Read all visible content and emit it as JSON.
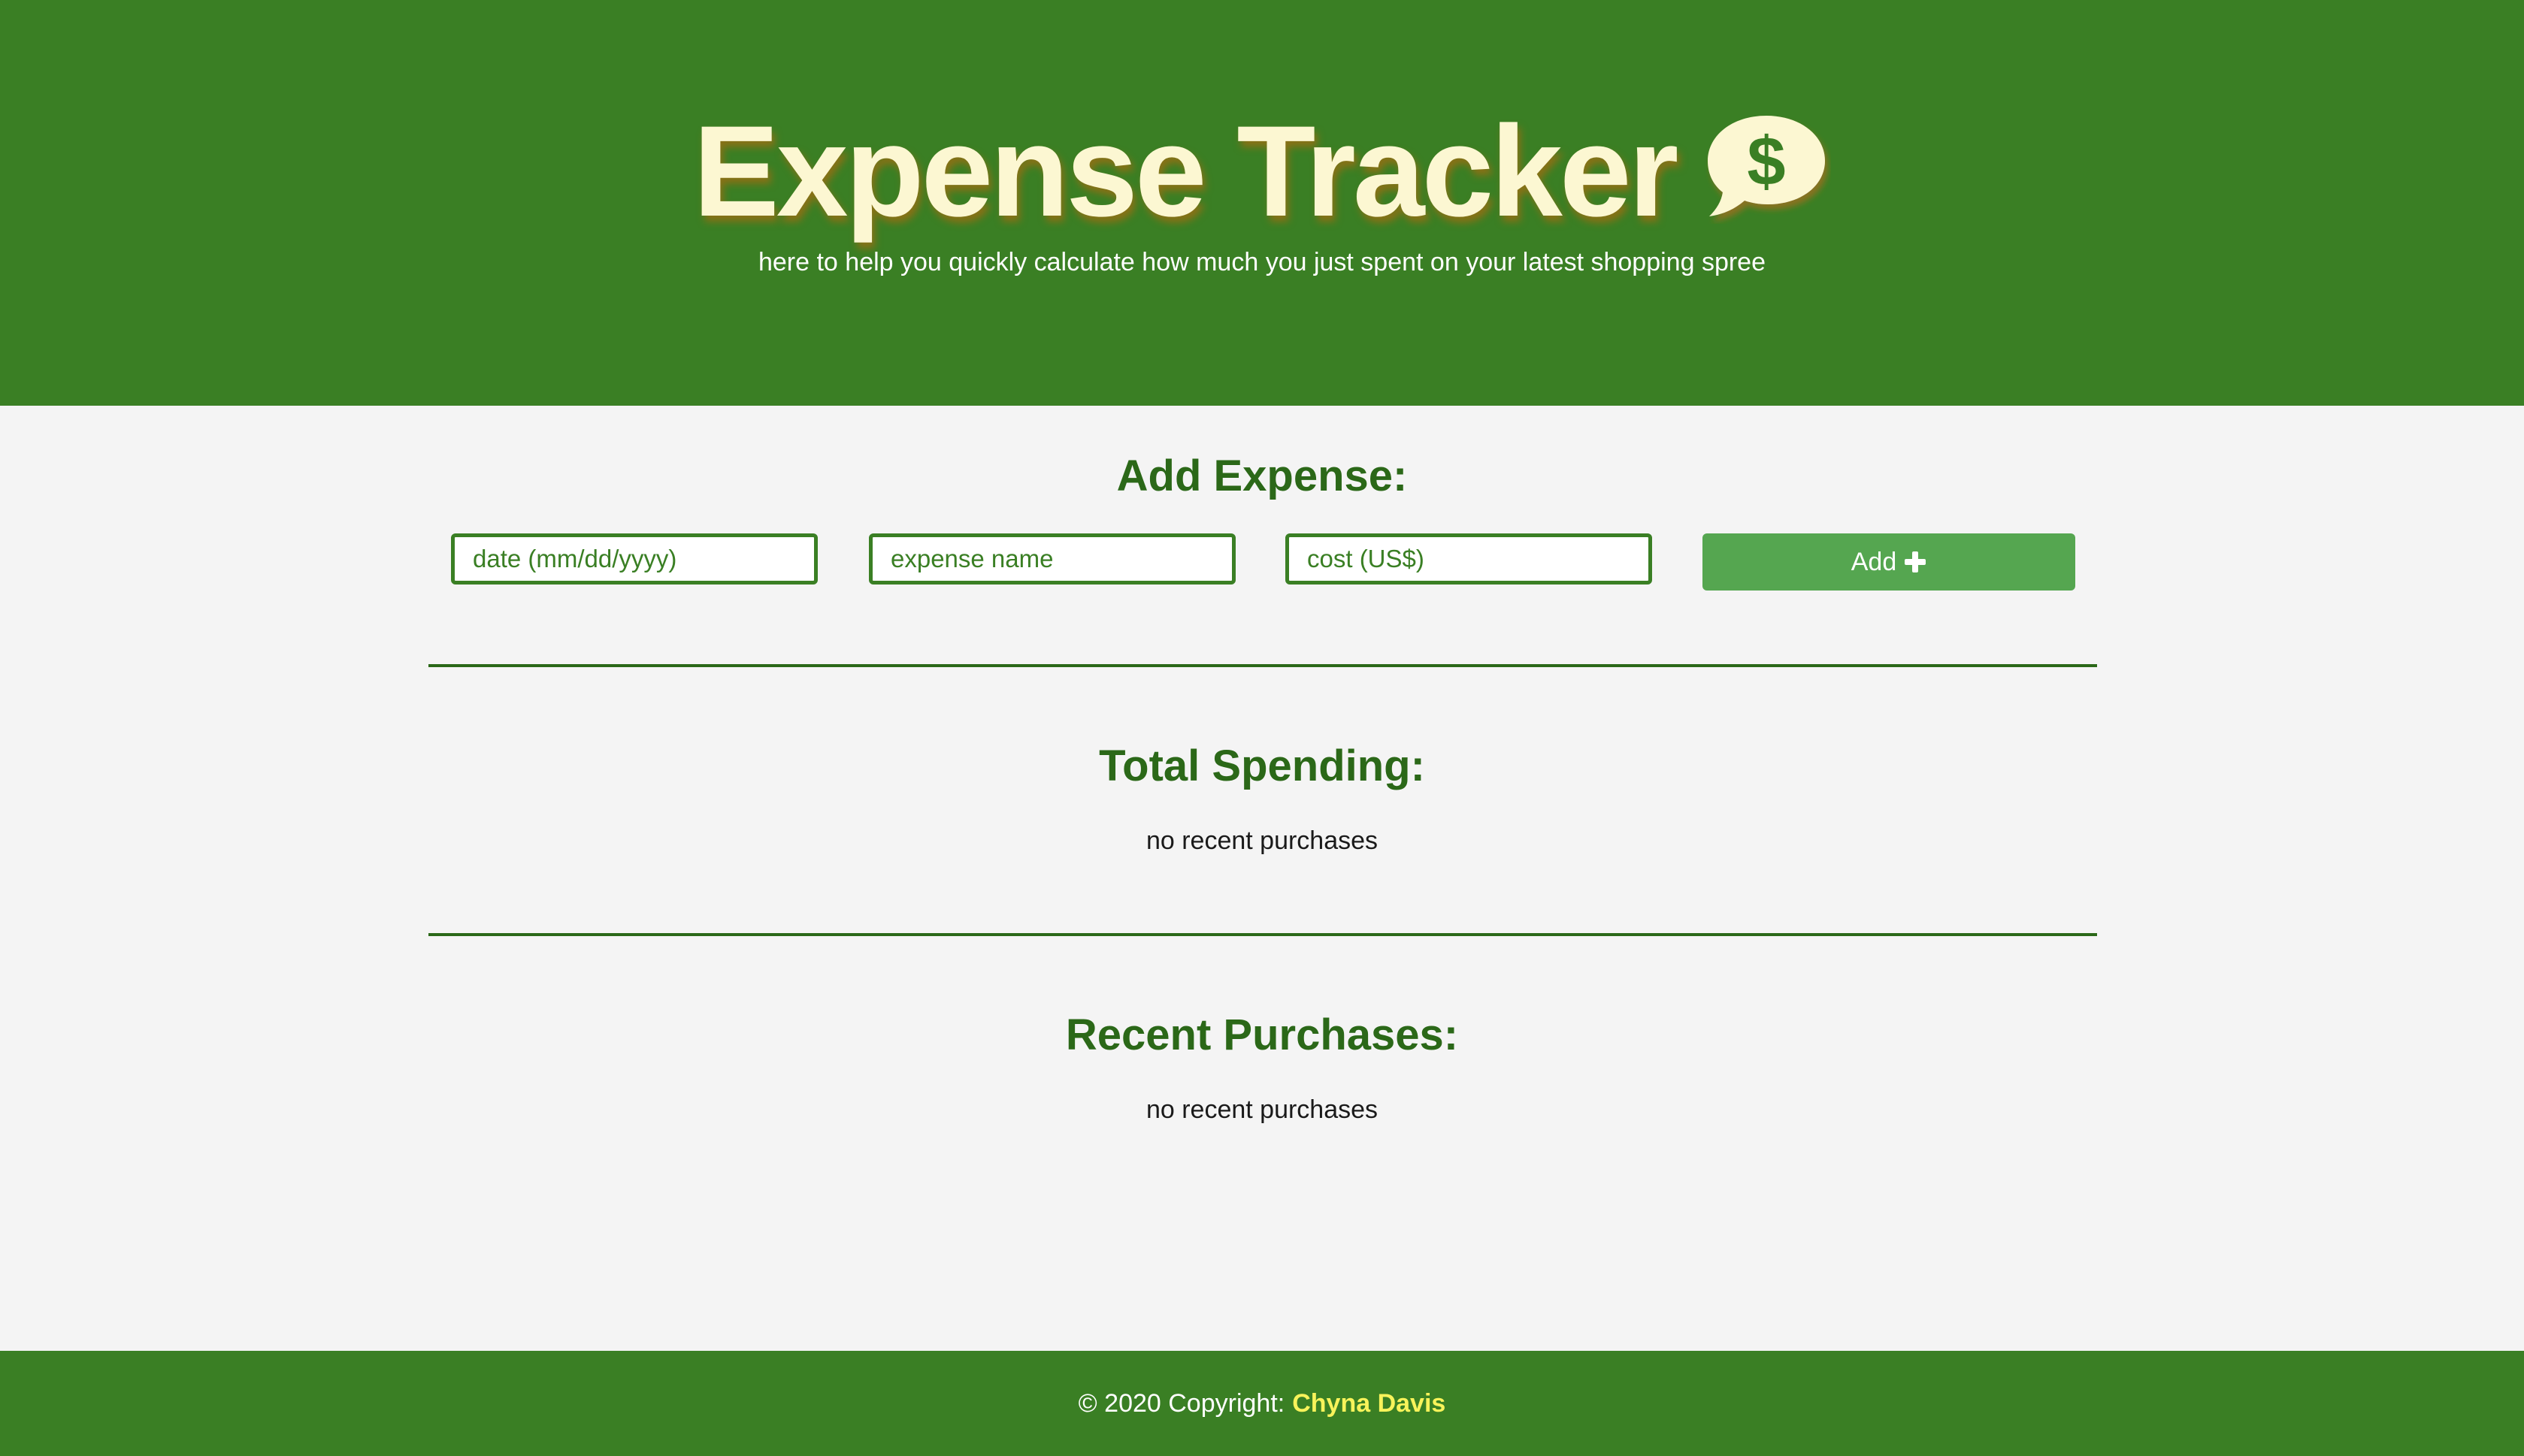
{
  "header": {
    "title": "Expense Tracker",
    "title_icon": "dollar-speech-bubble-icon",
    "subtitle": "here to help you quickly calculate how much you just spent on your latest shopping spree"
  },
  "add_expense": {
    "heading": "Add Expense:",
    "date_placeholder": "date (mm/dd/yyyy)",
    "name_placeholder": "expense name",
    "cost_placeholder": "cost (US$)",
    "add_label": "Add",
    "add_icon": "plus-icon"
  },
  "total_spending": {
    "heading": "Total Spending:",
    "empty_text": "no recent purchases"
  },
  "recent_purchases": {
    "heading": "Recent Purchases:",
    "empty_text": "no recent purchases"
  },
  "footer": {
    "copyright": "© 2020 Copyright:",
    "author": "Chyna Davis"
  },
  "colors": {
    "primary_green": "#3a7f24",
    "heading_green": "#2b6818",
    "button_green": "#55a650",
    "title_cream": "#fcf7d2",
    "footer_author_yellow": "#f8f35a",
    "background": "#f4f4f4"
  }
}
